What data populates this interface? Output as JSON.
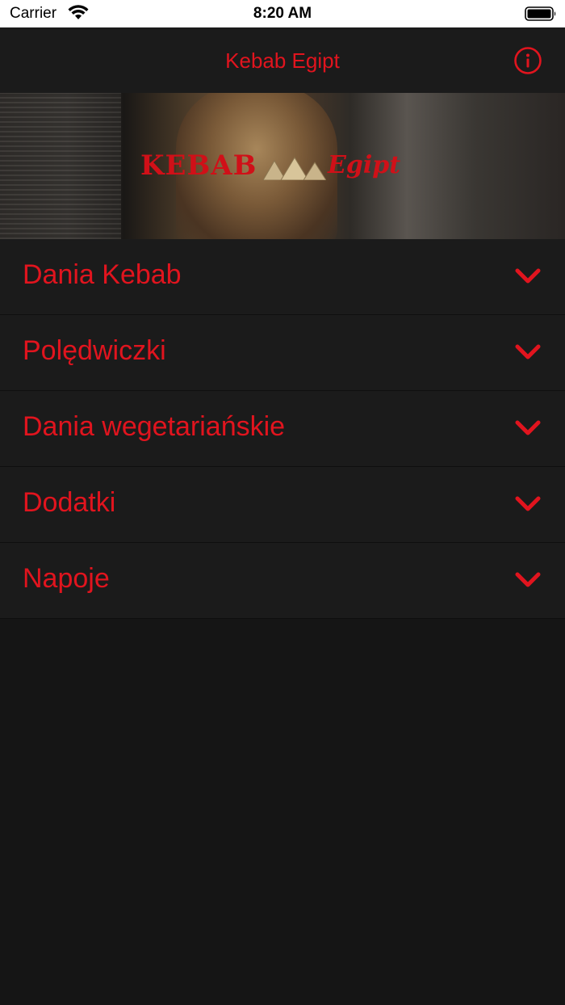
{
  "status_bar": {
    "carrier": "Carrier",
    "time": "8:20 AM"
  },
  "nav": {
    "title": "Kebab Egipt",
    "info_icon": "info-icon"
  },
  "hero": {
    "logo_left": "KEBAB",
    "logo_right": "Egipt"
  },
  "menu": {
    "items": [
      {
        "label": "Dania Kebab",
        "icon": "chevron-down-icon"
      },
      {
        "label": "Polędwiczki",
        "icon": "chevron-down-icon"
      },
      {
        "label": "Dania wegetariańskie",
        "icon": "chevron-down-icon"
      },
      {
        "label": "Dodatki",
        "icon": "chevron-down-icon"
      },
      {
        "label": "Napoje",
        "icon": "chevron-down-icon"
      }
    ]
  },
  "colors": {
    "accent": "#e1141e",
    "background": "#151515",
    "row_background": "#1b1b1b"
  }
}
